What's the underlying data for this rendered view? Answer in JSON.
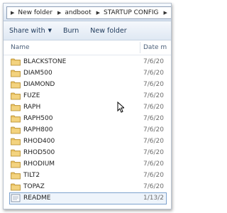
{
  "address_bar": {
    "crumbs": [
      "New folder",
      "andboot",
      "STARTUP CONFIG"
    ]
  },
  "toolbar": {
    "share_with_label": "Share with",
    "burn_label": "Burn",
    "new_folder_label": "New folder"
  },
  "columns": {
    "name": "Name",
    "date_modified": "Date m"
  },
  "files": [
    {
      "name": "BLACKSTONE",
      "date": "7/6/20",
      "type": "folder"
    },
    {
      "name": "DIAM500",
      "date": "7/6/20",
      "type": "folder"
    },
    {
      "name": "DIAMOND",
      "date": "7/6/20",
      "type": "folder"
    },
    {
      "name": "FUZE",
      "date": "7/6/20",
      "type": "folder"
    },
    {
      "name": "RAPH",
      "date": "7/6/20",
      "type": "folder"
    },
    {
      "name": "RAPH500",
      "date": "7/6/20",
      "type": "folder"
    },
    {
      "name": "RAPH800",
      "date": "7/6/20",
      "type": "folder"
    },
    {
      "name": "RHOD400",
      "date": "7/6/20",
      "type": "folder"
    },
    {
      "name": "RHOD500",
      "date": "7/6/20",
      "type": "folder"
    },
    {
      "name": "RHODIUM",
      "date": "7/6/20",
      "type": "folder"
    },
    {
      "name": "TILT2",
      "date": "7/6/20",
      "type": "folder"
    },
    {
      "name": "TOPAZ",
      "date": "7/6/20",
      "type": "folder"
    },
    {
      "name": "README",
      "date": "1/13/2",
      "type": "text-file"
    }
  ],
  "colors": {
    "folder_fill": "#e8c060",
    "selection_border": "#7da2ce",
    "toolbar_text": "#1e395b"
  }
}
